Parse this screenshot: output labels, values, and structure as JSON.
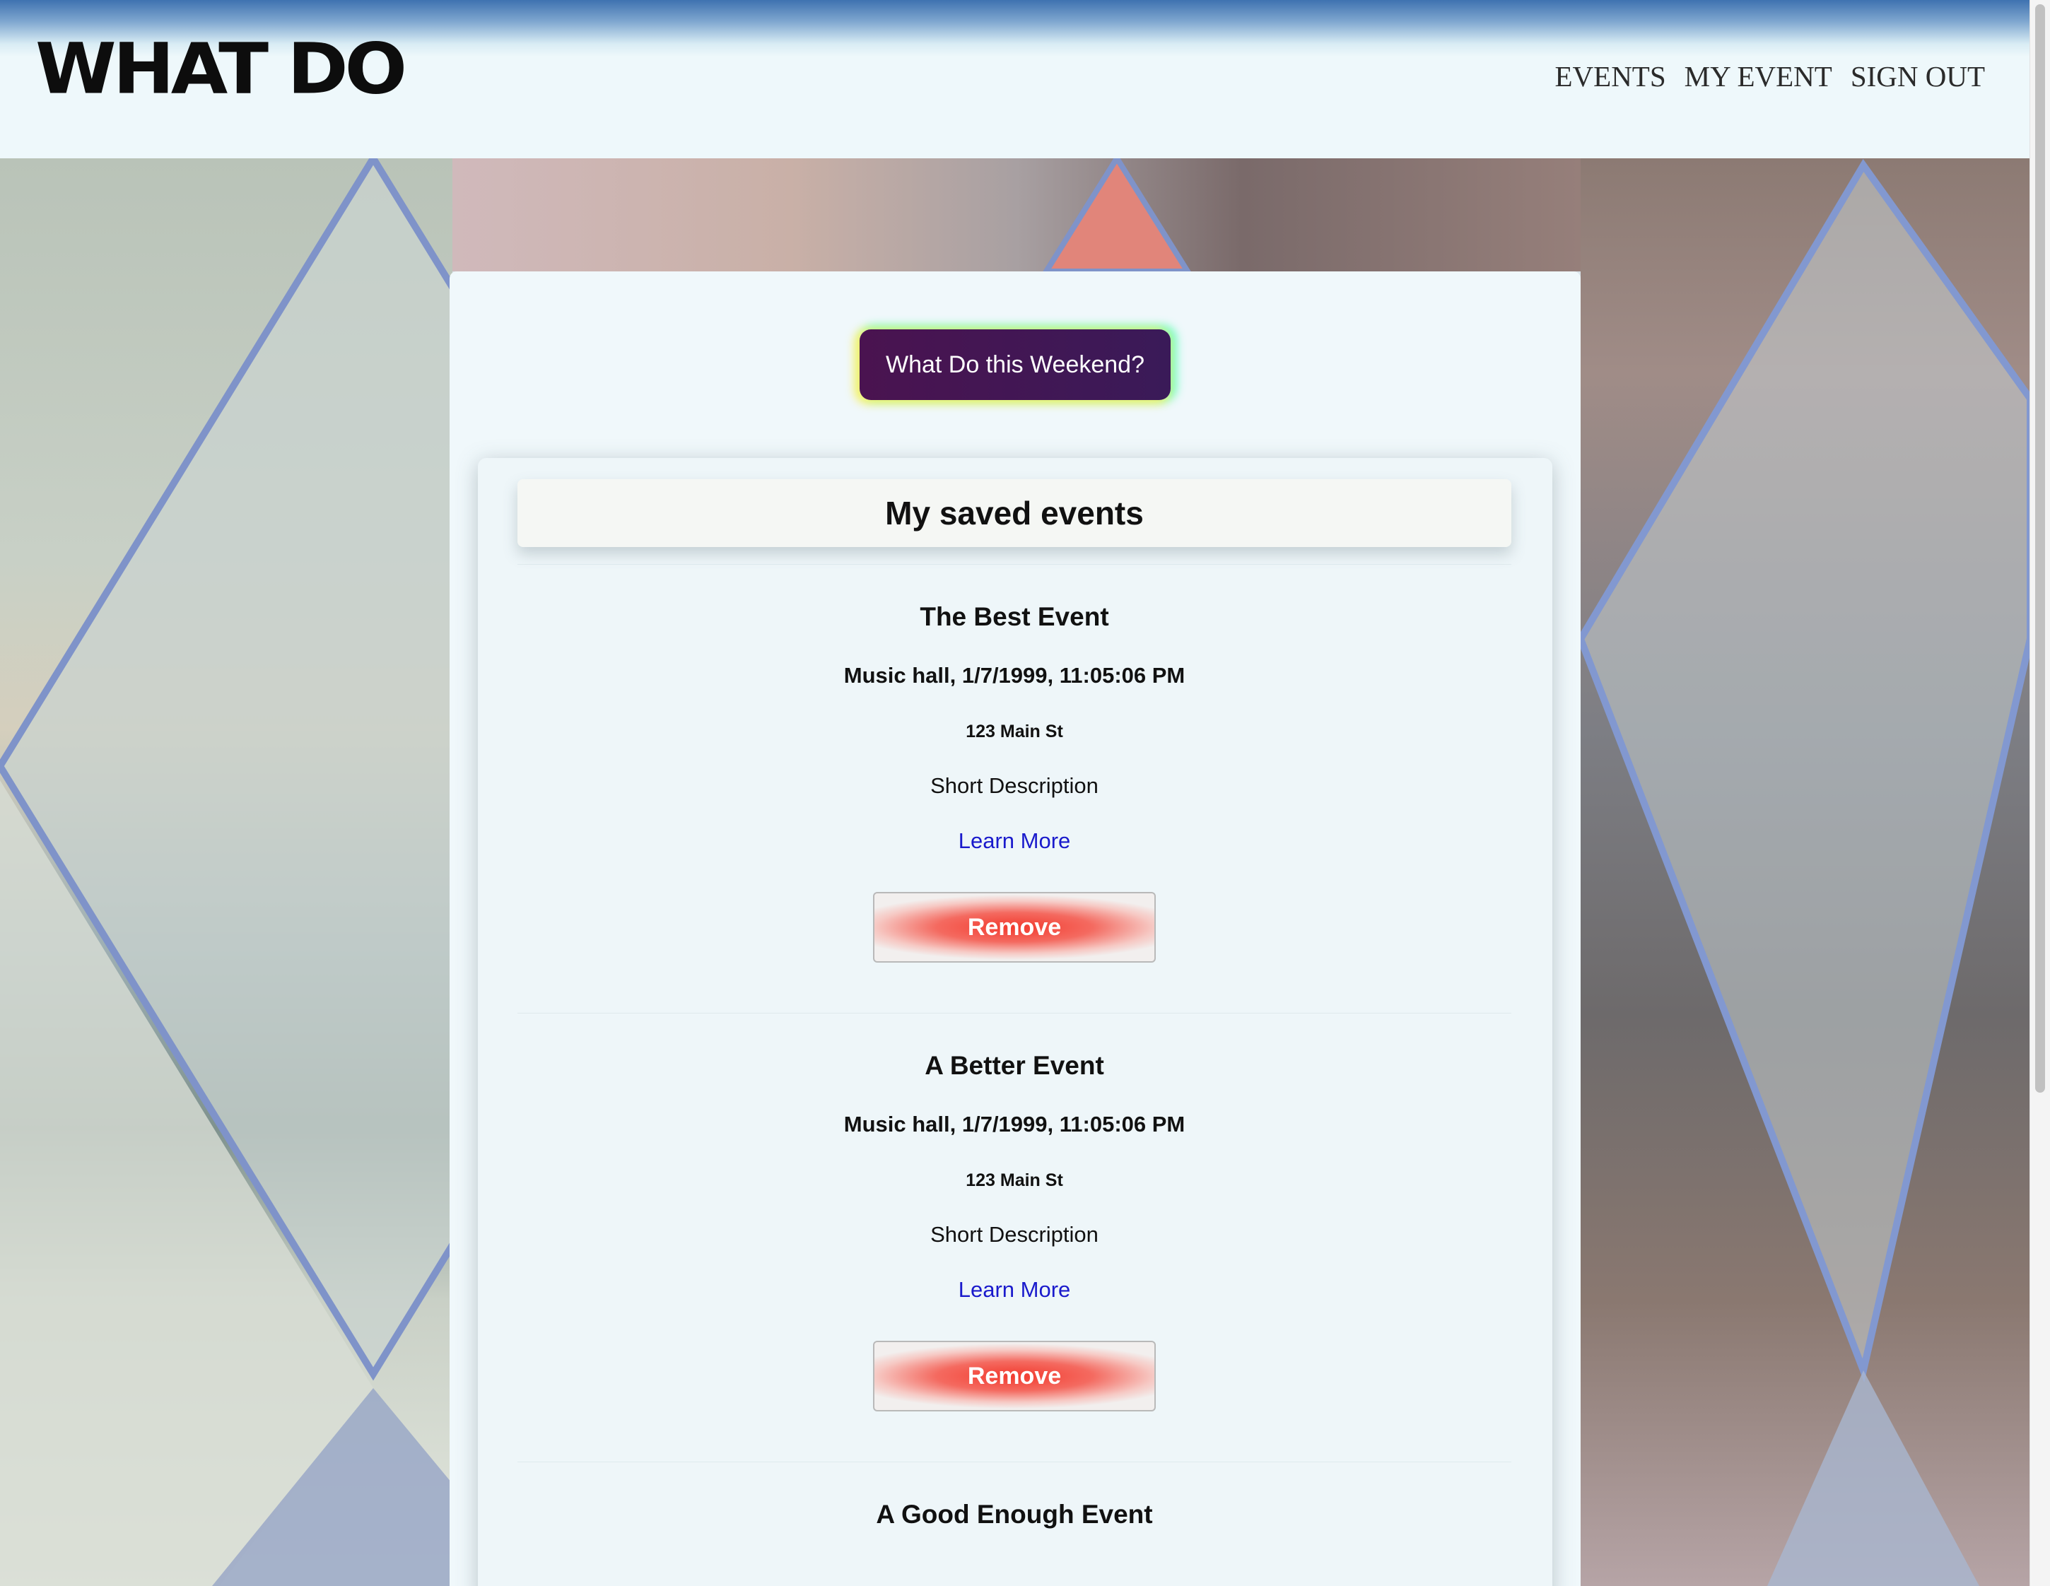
{
  "header": {
    "logo": "WHAT DO",
    "nav": [
      "EVENTS",
      "MY EVENT",
      "SIGN OUT"
    ]
  },
  "main": {
    "weekend_button": "What Do this Weekend?",
    "saved_title": "My saved events",
    "events": [
      {
        "name": "The Best Event",
        "when": "Music hall, 1/7/1999, 11:05:06 PM",
        "address": "123 Main St",
        "description": "Short Description",
        "link": "Learn More",
        "remove": "Remove"
      },
      {
        "name": "A Better Event",
        "when": "Music hall, 1/7/1999, 11:05:06 PM",
        "address": "123 Main St",
        "description": "Short Description",
        "link": "Learn More",
        "remove": "Remove"
      },
      {
        "name": "A Good Enough Event"
      }
    ]
  },
  "colors": {
    "header_top": "#3f72b0",
    "header_bg": "#eef8fb",
    "weekend_button": "#4a1350",
    "remove_button": "#f23a2e",
    "link": "#1a1acc"
  }
}
